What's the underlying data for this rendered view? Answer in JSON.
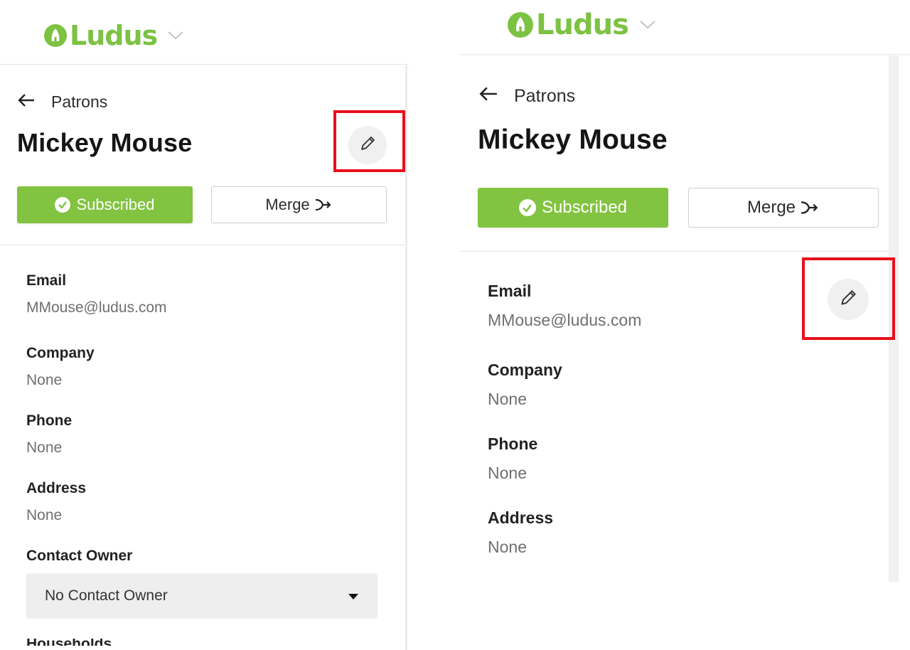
{
  "brand": {
    "name": "Ludus",
    "color": "#7cc243"
  },
  "back_label": "Patrons",
  "patron_name": "Mickey Mouse",
  "buttons": {
    "subscribed": "Subscribed",
    "merge": "Merge"
  },
  "fields": [
    {
      "label": "Email",
      "value": "MMouse@ludus.com"
    },
    {
      "label": "Company",
      "value": "None"
    },
    {
      "label": "Phone",
      "value": "None"
    },
    {
      "label": "Address",
      "value": "None"
    }
  ],
  "contact_owner": {
    "label": "Contact Owner",
    "selected": "No Contact Owner"
  },
  "next_field_label": "Households",
  "highlight_color": "#e8101c",
  "accent_color": "#82c341",
  "icons": [
    "logo-icon",
    "chevron-down-icon",
    "arrow-left-icon",
    "pencil-icon",
    "check-circle-icon",
    "merge-icon",
    "caret-down-icon"
  ]
}
